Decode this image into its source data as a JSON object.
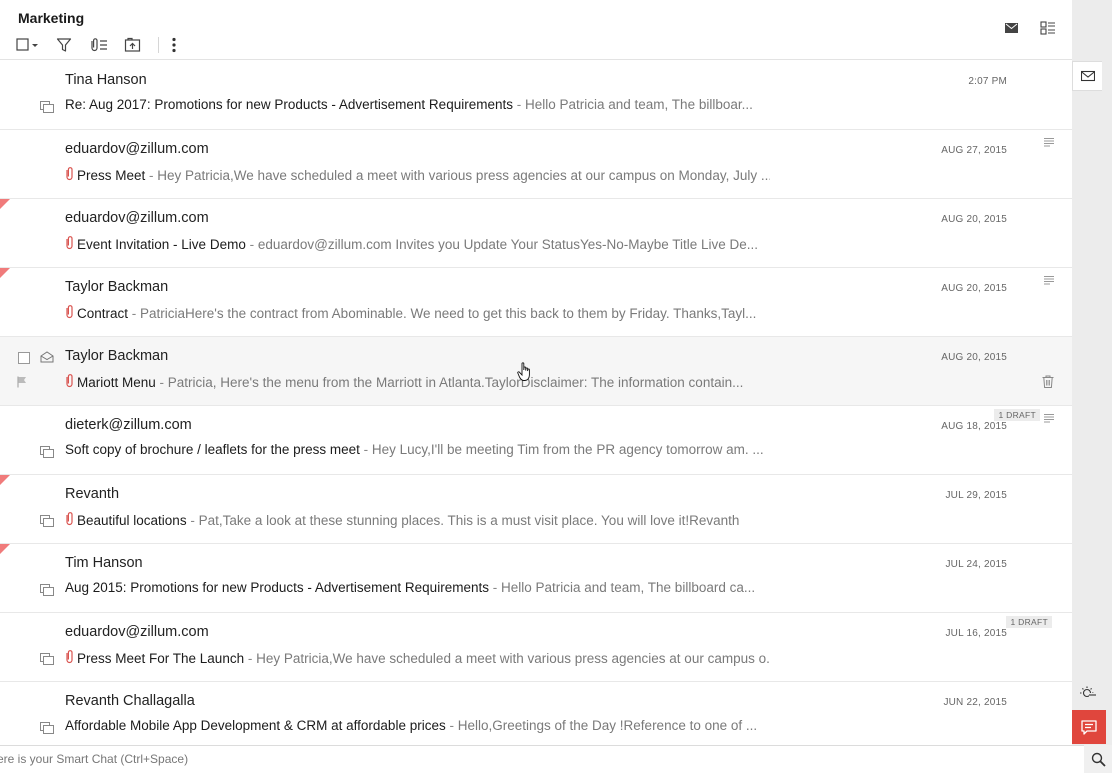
{
  "header": {
    "folder_title": "Marketing"
  },
  "chat": {
    "placeholder": "ere is your Smart Chat (Ctrl+Space)"
  },
  "colors": {
    "flag_red": "#f07b7b",
    "chat_button": "#e0463d"
  },
  "emails": [
    {
      "sender": "Tina Hanson",
      "subject": "Re: Aug 2017: Promotions for new Products - Advertisement Requirements",
      "snippet": "Hello Patricia and team, The billboar...",
      "date": "2:07 PM",
      "attachment": false
    },
    {
      "sender": "eduardov@zillum.com",
      "subject": "Press Meet",
      "snippet": "Hey Patricia,We have scheduled a meet with various press agencies at our campus on Monday, July ...",
      "date": "AUG 27, 2015",
      "attachment": true
    },
    {
      "sender": "eduardov@zillum.com",
      "subject": "Event Invitation - Live Demo",
      "snippet": "eduardov@zillum.com Invites you Update Your StatusYes-No-Maybe Title Live De...",
      "date": "AUG 20, 2015",
      "attachment": true
    },
    {
      "sender": "Taylor Backman",
      "subject": "Contract",
      "snippet": "PatriciaHere's the contract from Abominable. We need to get this back to them by Friday. Thanks,Tayl...",
      "date": "AUG 20, 2015",
      "attachment": true
    },
    {
      "sender": "Taylor Backman",
      "subject": "Mariott Menu",
      "snippet": "Patricia, Here's the menu from the Marriott in Atlanta.TaylorDisclaimer: The information contain...",
      "date": "AUG 20, 2015",
      "attachment": true
    },
    {
      "sender": "dieterk@zillum.com",
      "subject": "Soft copy of brochure / leaflets for the press meet",
      "snippet": "Hey Lucy,I'll be meeting Tim from the PR agency tomorrow am. ...",
      "date": "AUG 18, 2015",
      "attachment": false,
      "draft": "1 DRAFT"
    },
    {
      "sender": "Revanth",
      "subject": "Beautiful locations",
      "snippet": "Pat,Take a look at these stunning places. This is a must visit place. You will love it!Revanth        ...",
      "date": "JUL 29, 2015",
      "attachment": true
    },
    {
      "sender": "Tim Hanson",
      "subject": "Aug 2015: Promotions for new Products - Advertisement Requirements",
      "snippet": "Hello Patricia and team, The billboard ca...",
      "date": "JUL 24, 2015",
      "attachment": false
    },
    {
      "sender": "eduardov@zillum.com",
      "subject": "Press Meet For The Launch",
      "snippet": "Hey Patricia,We have scheduled a meet with various press agencies at our campus o...",
      "date": "JUL 16, 2015",
      "attachment": true,
      "draft": "1 DRAFT"
    },
    {
      "sender": "Revanth Challagalla",
      "subject": "Affordable Mobile App Development & CRM at affordable prices",
      "snippet": "Hello,Greetings of the Day !Reference to one of ...",
      "date": "JUN 22, 2015",
      "attachment": false
    }
  ]
}
